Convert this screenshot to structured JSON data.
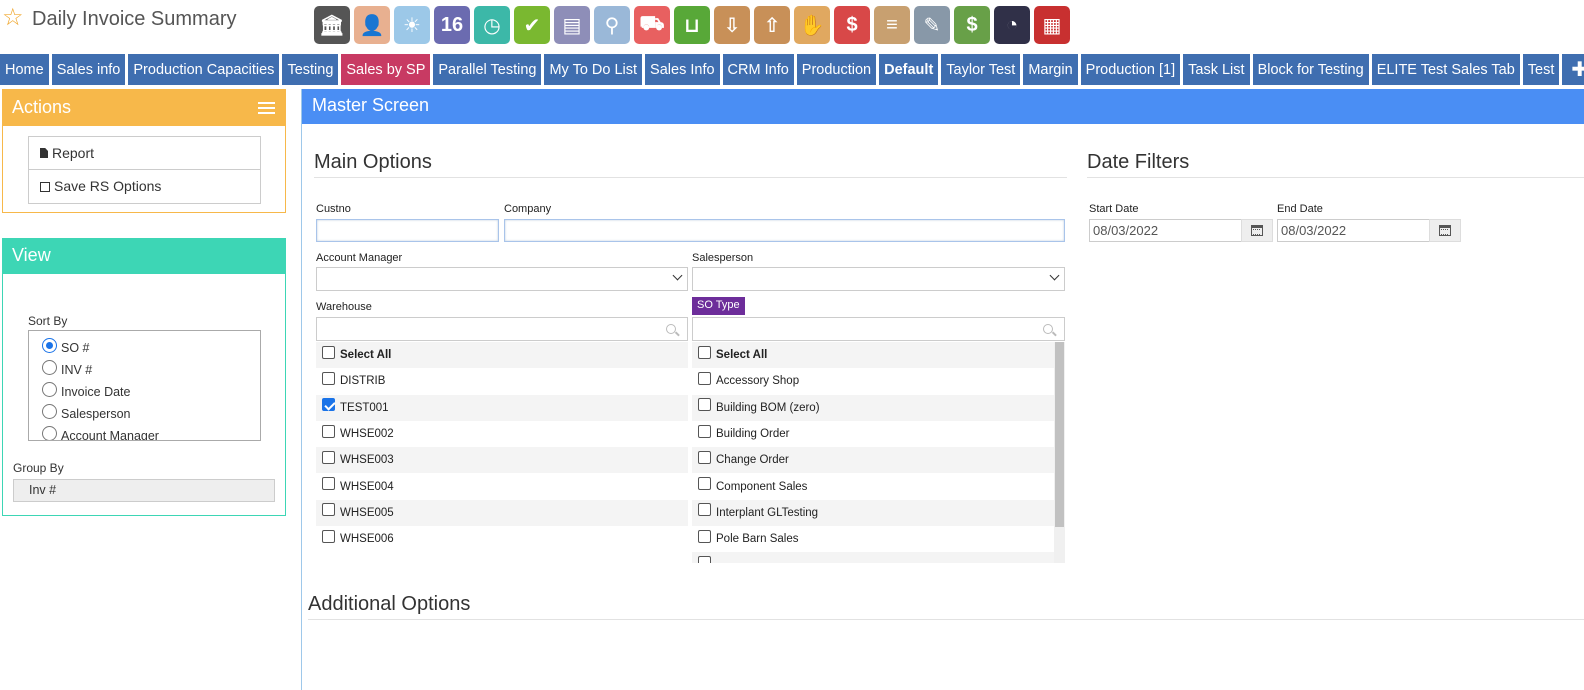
{
  "header": {
    "title": "Daily Invoice Summary"
  },
  "toolbar": {
    "icons": [
      {
        "name": "bank-icon",
        "color": "#555555",
        "glyph": "🏛"
      },
      {
        "name": "user-icon",
        "color": "#e8b090",
        "glyph": "👤"
      },
      {
        "name": "weather-icon",
        "color": "#9cc8e8",
        "glyph": "☀"
      },
      {
        "name": "calendar-16-icon",
        "color": "#6b6bb0",
        "glyph": "16"
      },
      {
        "name": "clock-icon",
        "color": "#3cb8a8",
        "glyph": "◷"
      },
      {
        "name": "checkmark-icon",
        "color": "#7ab830",
        "glyph": "✔"
      },
      {
        "name": "window-icon",
        "color": "#8e8eb8",
        "glyph": "▤"
      },
      {
        "name": "magnifier-icon",
        "color": "#9ab8d8",
        "glyph": "⚲"
      },
      {
        "name": "truck-icon",
        "color": "#e86060",
        "glyph": "⛟"
      },
      {
        "name": "basket-icon",
        "color": "#58a838",
        "glyph": "⊔"
      },
      {
        "name": "inbox-download-icon",
        "color": "#c89058",
        "glyph": "⇩"
      },
      {
        "name": "inbox-upload-icon",
        "color": "#c89058",
        "glyph": "⇧"
      },
      {
        "name": "hand-money-icon",
        "color": "#e0a860",
        "glyph": "✋"
      },
      {
        "name": "price-tag-icon",
        "color": "#d84848",
        "glyph": "$"
      },
      {
        "name": "clipboard-icon",
        "color": "#c8a070",
        "glyph": "≡"
      },
      {
        "name": "pencil-icon",
        "color": "#8898a8",
        "glyph": "✎"
      },
      {
        "name": "money-icon",
        "color": "#68a048",
        "glyph": "$"
      },
      {
        "name": "gauge-icon",
        "color": "#303048",
        "glyph": "◔"
      },
      {
        "name": "building-icon",
        "color": "#c83030",
        "glyph": "▦"
      }
    ]
  },
  "nav": {
    "tabs": [
      {
        "label": "Home",
        "active": false,
        "bold": false
      },
      {
        "label": "Sales info",
        "active": false,
        "bold": false
      },
      {
        "label": "Production Capacities",
        "active": false,
        "bold": false
      },
      {
        "label": "Testing",
        "active": false,
        "bold": false
      },
      {
        "label": "Sales by SP",
        "active": true,
        "bold": false
      },
      {
        "label": "Parallel Testing",
        "active": false,
        "bold": false
      },
      {
        "label": "My To Do List",
        "active": false,
        "bold": false
      },
      {
        "label": "Sales Info",
        "active": false,
        "bold": false
      },
      {
        "label": "CRM Info",
        "active": false,
        "bold": false
      },
      {
        "label": "Production",
        "active": false,
        "bold": false
      },
      {
        "label": "Default",
        "active": false,
        "bold": true
      },
      {
        "label": "Taylor Test",
        "active": false,
        "bold": false
      },
      {
        "label": "Margin",
        "active": false,
        "bold": false
      },
      {
        "label": "Production [1]",
        "active": false,
        "bold": false
      },
      {
        "label": "Task List",
        "active": false,
        "bold": false
      },
      {
        "label": "Block for Testing",
        "active": false,
        "bold": false
      },
      {
        "label": "ELITE Test Sales Tab",
        "active": false,
        "bold": false
      },
      {
        "label": "Test",
        "active": false,
        "bold": false
      }
    ],
    "add_label": "✚"
  },
  "actions": {
    "title": "Actions",
    "items": [
      {
        "label": "Report",
        "icon": "file-icon"
      },
      {
        "label": "Save RS Options",
        "icon": "save-icon"
      }
    ]
  },
  "view": {
    "title": "View",
    "sort_by_label": "Sort By",
    "sort_options": [
      {
        "label": "SO #",
        "selected": true
      },
      {
        "label": "INV #",
        "selected": false
      },
      {
        "label": "Invoice Date",
        "selected": false
      },
      {
        "label": "Salesperson",
        "selected": false
      },
      {
        "label": "Account Manager",
        "selected": false
      }
    ],
    "group_by_label": "Group By",
    "group_by_value": "Inv #"
  },
  "master": {
    "title": "Master Screen"
  },
  "main_options": {
    "title": "Main Options",
    "custno_label": "Custno",
    "custno_value": "",
    "company_label": "Company",
    "company_value": "",
    "account_manager_label": "Account Manager",
    "account_manager_value": "",
    "salesperson_label": "Salesperson",
    "salesperson_value": "",
    "warehouse_label": "Warehouse",
    "warehouse_search": "",
    "warehouse_items": [
      {
        "label": "Select All",
        "checked": false,
        "bold": true
      },
      {
        "label": "DISTRIB",
        "checked": false,
        "bold": false
      },
      {
        "label": "TEST001",
        "checked": true,
        "bold": false
      },
      {
        "label": "WHSE002",
        "checked": false,
        "bold": false
      },
      {
        "label": "WHSE003",
        "checked": false,
        "bold": false
      },
      {
        "label": "WHSE004",
        "checked": false,
        "bold": false
      },
      {
        "label": "WHSE005",
        "checked": false,
        "bold": false
      },
      {
        "label": "WHSE006",
        "checked": false,
        "bold": false
      }
    ],
    "so_type_label": "SO Type",
    "so_type_search": "",
    "so_type_items": [
      {
        "label": "Select All",
        "checked": false,
        "bold": true
      },
      {
        "label": "Accessory Shop",
        "checked": false,
        "bold": false
      },
      {
        "label": "Building BOM (zero)",
        "checked": false,
        "bold": false
      },
      {
        "label": "Building Order",
        "checked": false,
        "bold": false
      },
      {
        "label": "Change Order",
        "checked": false,
        "bold": false
      },
      {
        "label": "Component Sales",
        "checked": false,
        "bold": false
      },
      {
        "label": "Interplant GLTesting",
        "checked": false,
        "bold": false
      },
      {
        "label": "Pole Barn Sales",
        "checked": false,
        "bold": false
      },
      {
        "label": "",
        "checked": false,
        "bold": false
      }
    ]
  },
  "date_filters": {
    "title": "Date Filters",
    "start_label": "Start Date",
    "start_value": "08/03/2022",
    "end_label": "End Date",
    "end_value": "08/03/2022"
  },
  "additional_options": {
    "title": "Additional Options"
  }
}
